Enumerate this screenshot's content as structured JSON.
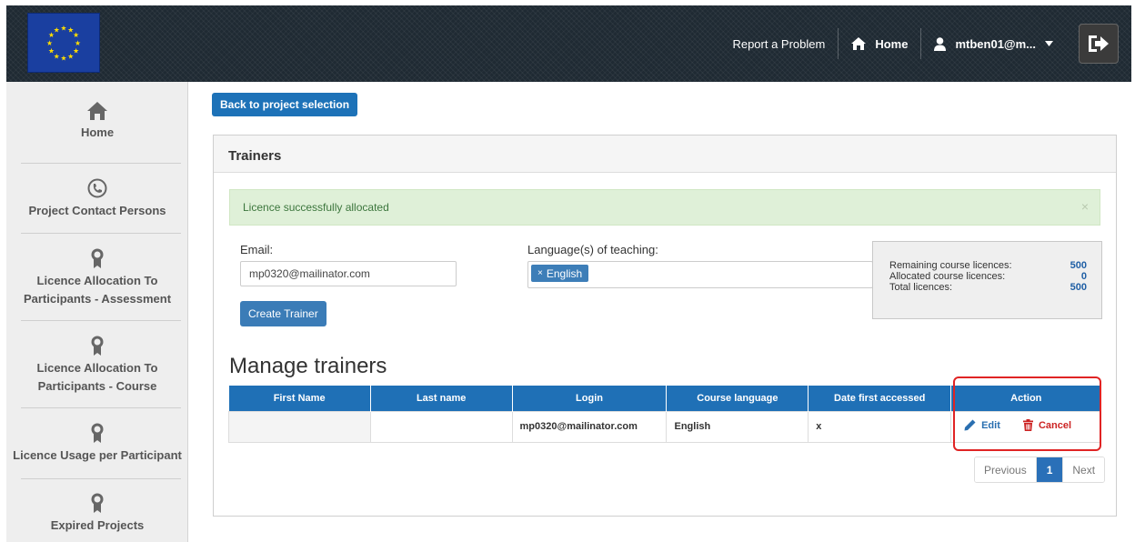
{
  "topnav": {
    "report_problem": "Report a Problem",
    "home": "Home",
    "user": "mtben01@m...",
    "icons": {
      "home": "home-icon",
      "user": "user-icon",
      "caret": "caret-down-icon",
      "logout": "logout-icon"
    }
  },
  "sidebar": {
    "items": [
      {
        "label": "Home",
        "icon": "home-icon"
      },
      {
        "label": "Project Contact Persons",
        "icon": "phone-icon"
      },
      {
        "label_line1": "Licence Allocation To",
        "label_line2": "Participants - Assessment",
        "icon": "award-icon"
      },
      {
        "label_line1": "Licence Allocation To",
        "label_line2": "Participants - Course",
        "icon": "award-icon"
      },
      {
        "label": "Licence Usage per Participant",
        "icon": "award-icon"
      },
      {
        "label": "Expired Projects",
        "icon": "award-icon"
      }
    ]
  },
  "main": {
    "back_button": "Back to project selection",
    "panel_title": "Trainers",
    "alert_text": "Licence successfully allocated",
    "alert_close": "×",
    "email_label": "Email:",
    "email_value": "mp0320@mailinator.com",
    "language_label": "Language(s) of teaching:",
    "language_tag": "English",
    "language_tag_remove": "×",
    "create_button": "Create Trainer",
    "stats": {
      "remaining_label": "Remaining course licences:",
      "remaining_value": "500",
      "allocated_label": "Allocated course licences:",
      "allocated_value": "0",
      "total_label": "Total licences:",
      "total_value": "500"
    },
    "manage_title": "Manage trainers",
    "table": {
      "headers": [
        "First Name",
        "Last name",
        "Login",
        "Course language",
        "Date first accessed",
        "Action"
      ],
      "rows": [
        {
          "first_name": "",
          "last_name": "",
          "login": "mp0320@mailinator.com",
          "course_language": "English",
          "date_first_accessed": "x"
        }
      ],
      "actions": {
        "edit": "Edit",
        "cancel": "Cancel"
      }
    },
    "pagination": {
      "previous": "Previous",
      "current": "1",
      "next": "Next"
    }
  },
  "colors": {
    "primary": "#1f70b6",
    "alert_bg": "#dff0d8",
    "alert_text": "#3c763d",
    "cancel": "#cc2222",
    "highlight": "#e02424"
  }
}
